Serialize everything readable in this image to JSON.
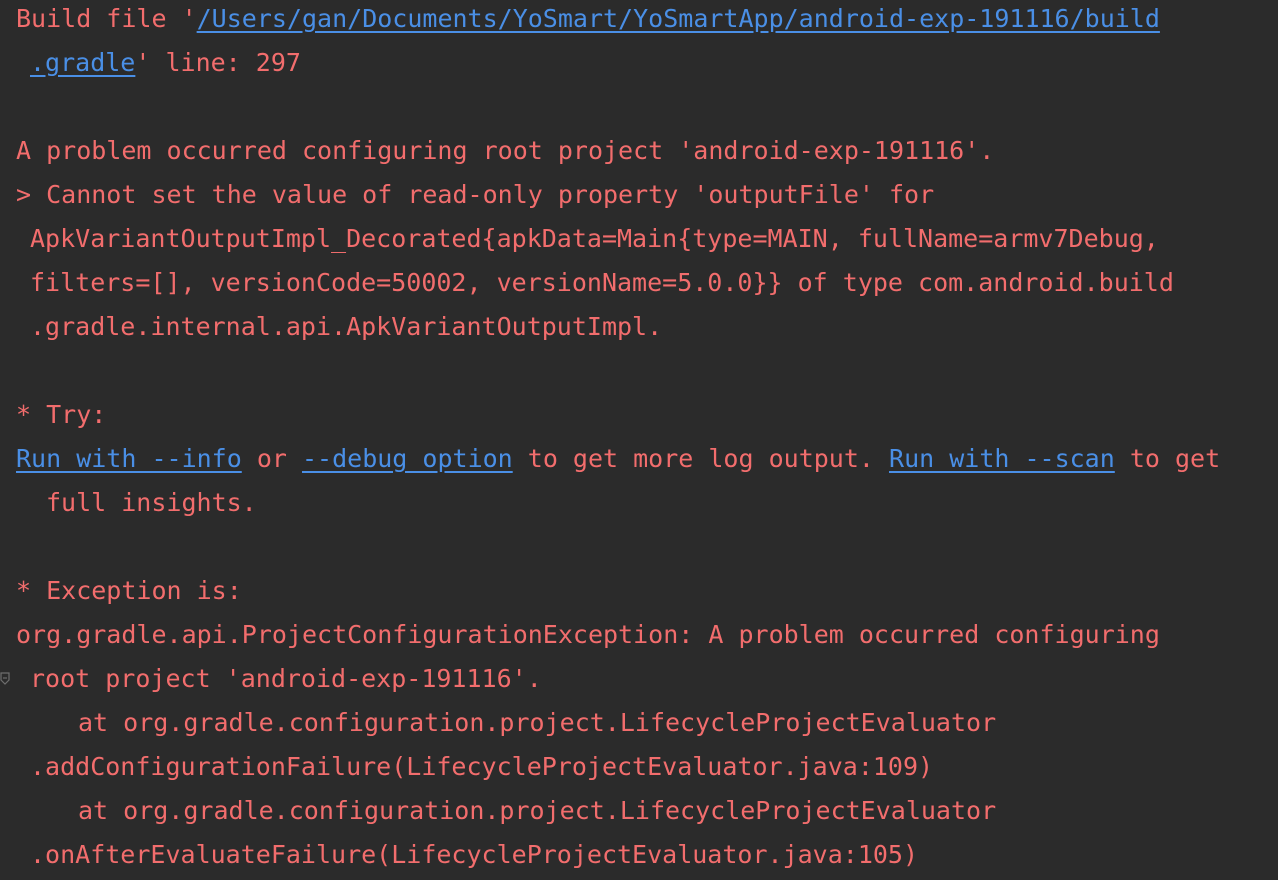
{
  "console": {
    "l1": {
      "prefix": "Build file '",
      "link": "/Users/gan/Documents/YoSmart/YoSmartApp/android-exp-191116/build"
    },
    "l2": {
      "link": ".gradle",
      "suffix": "' line: 297"
    },
    "l3": "A problem occurred configuring root project 'android-exp-191116'.",
    "l4": "> Cannot set the value of read-only property 'outputFile' for",
    "l5": "ApkVariantOutputImpl_Decorated{apkData=Main{type=MAIN, fullName=armv7Debug,",
    "l6": "filters=[], versionCode=50002, versionName=5.0.0}} of type com.android.build",
    "l7": ".gradle.internal.api.ApkVariantOutputImpl.",
    "l8": "* Try:",
    "l9": {
      "link1": "Run with --info",
      "text1": " or ",
      "link2": "--debug option",
      "text2": " to get more log output. ",
      "link3": "Run with --scan",
      "text3": " to get"
    },
    "l10": "full insights.",
    "l11": "* Exception is:",
    "l12": "org.gradle.api.ProjectConfigurationException: A problem occurred configuring",
    "l13": "root project 'android-exp-191116'.",
    "l14": "at org.gradle.configuration.project.LifecycleProjectEvaluator",
    "l15": ".addConfigurationFailure(LifecycleProjectEvaluator.java:109)",
    "l16": "at org.gradle.configuration.project.LifecycleProjectEvaluator",
    "l17": ".onAfterEvaluateFailure(LifecycleProjectEvaluator.java:105)"
  },
  "colors": {
    "background": "#2b2b2b",
    "error_text": "#f26d6d",
    "link": "#4a8fe6"
  },
  "icons": {
    "fold": "fold-marker-icon"
  }
}
